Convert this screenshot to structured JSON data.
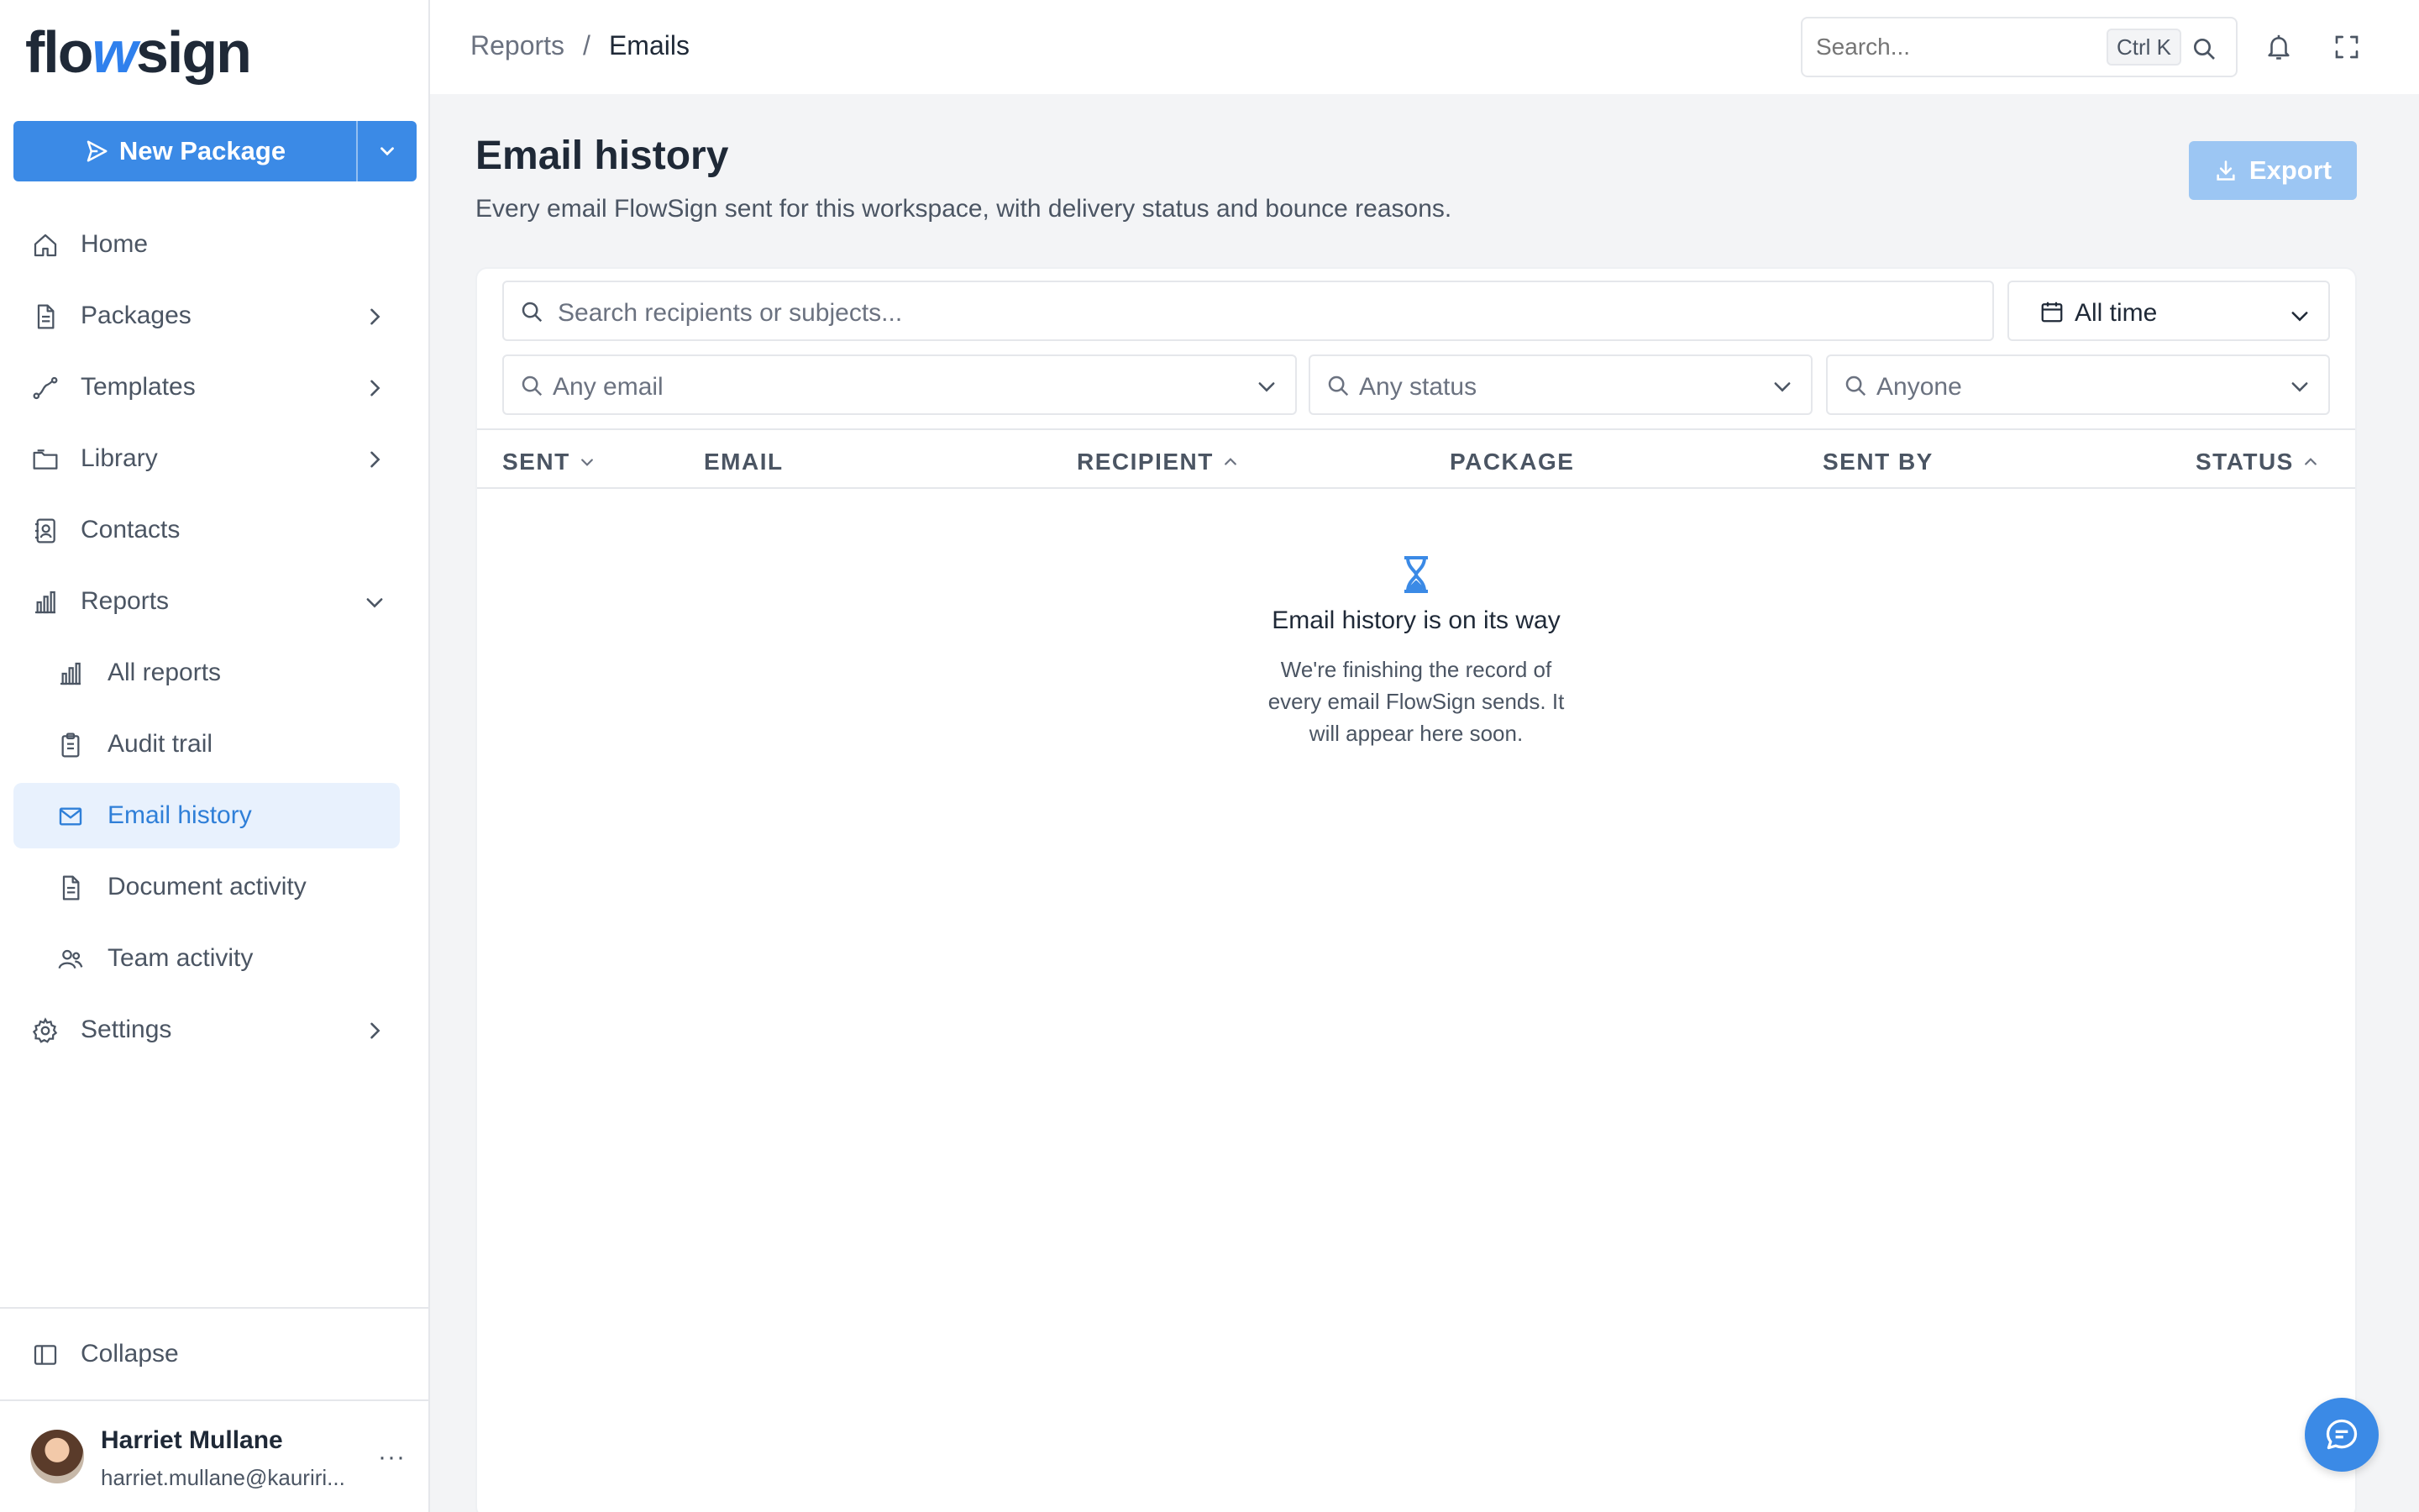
{
  "brand": {
    "logo_pre": "flo",
    "logo_w": "w",
    "logo_post": "sign",
    "accent": "#3b8ae6"
  },
  "sidebar": {
    "new_package_label": "New Package",
    "items": [
      {
        "label": "Home"
      },
      {
        "label": "Packages"
      },
      {
        "label": "Templates"
      },
      {
        "label": "Library"
      },
      {
        "label": "Contacts"
      },
      {
        "label": "Reports"
      }
    ],
    "reports_sub": [
      {
        "label": "All reports"
      },
      {
        "label": "Audit trail"
      },
      {
        "label": "Email history"
      },
      {
        "label": "Document activity"
      },
      {
        "label": "Team activity"
      }
    ],
    "settings_label": "Settings",
    "collapse_label": "Collapse",
    "user": {
      "name": "Harriet Mullane",
      "email": "harriet.mullane@kauriri...",
      "more": "···"
    }
  },
  "topbar": {
    "breadcrumb": {
      "parent": "Reports",
      "separator": "/",
      "current": "Emails"
    },
    "search": {
      "placeholder": "Search...",
      "shortcut": "Ctrl K"
    }
  },
  "page": {
    "title": "Email history",
    "subtitle": "Every email FlowSign sent for this workspace, with delivery status and bounce reasons.",
    "export_label": "Export"
  },
  "filters": {
    "search_placeholder": "Search recipients or subjects...",
    "date_range": "All time",
    "email_type": "Any email",
    "status": "Any status",
    "sender": "Anyone"
  },
  "table": {
    "columns": [
      "SENT",
      "EMAIL",
      "RECIPIENT",
      "PACKAGE",
      "SENT BY",
      "STATUS"
    ]
  },
  "empty_state": {
    "title": "Email history is on its way",
    "body": "We're finishing the record of every email FlowSign sends. It will appear here soon."
  }
}
